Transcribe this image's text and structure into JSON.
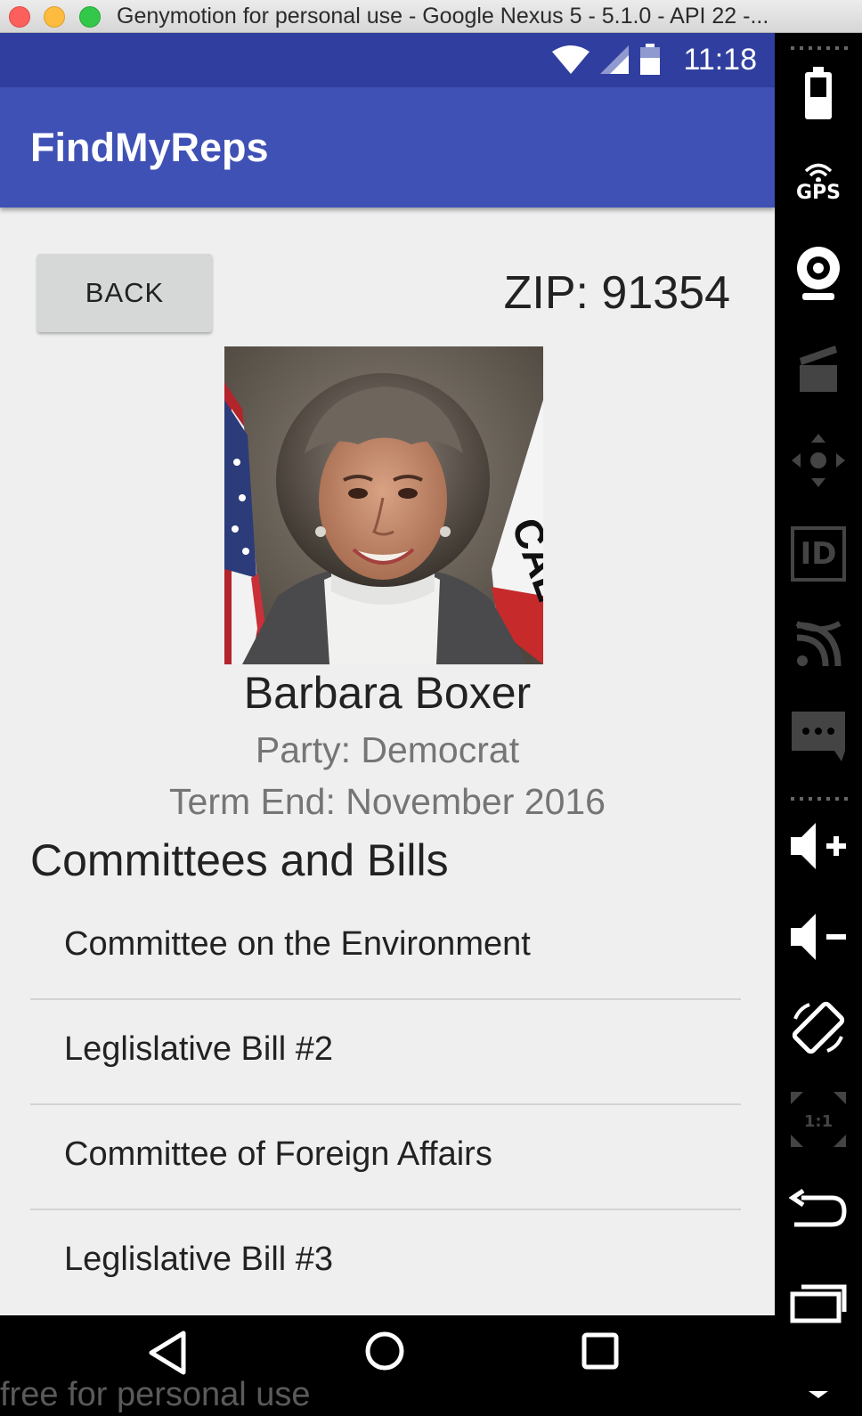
{
  "window": {
    "title": "Genymotion for personal use - Google Nexus 5 - 5.1.0 - API 22 -..."
  },
  "statusbar": {
    "time": "11:18"
  },
  "appbar": {
    "title": "FindMyReps"
  },
  "header": {
    "back_label": "BACK",
    "zip": "ZIP: 91354"
  },
  "rep": {
    "name": "Barbara Boxer",
    "party": "Party: Democrat",
    "term": "Term End: November 2016"
  },
  "section": {
    "title": "Committees and Bills"
  },
  "list": {
    "items": [
      {
        "label": "Committee on the Environment"
      },
      {
        "label": "Leglislative Bill #2"
      },
      {
        "label": "Committee of Foreign Affairs"
      },
      {
        "label": "Leglislative Bill #3"
      }
    ]
  },
  "watermark": "free for personal use",
  "sidebar": {
    "gps_label": "GPS",
    "id_label": "ID",
    "scale_label": "1:1"
  },
  "colors": {
    "primary": "#3f51b5",
    "primary_dark": "#303f9f"
  }
}
